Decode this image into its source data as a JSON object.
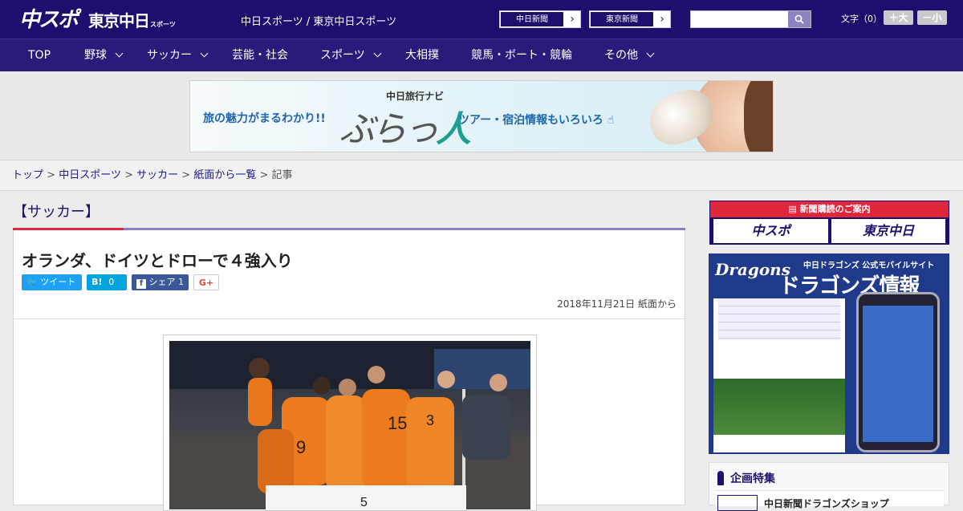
{
  "header": {
    "logo_main": "中スポ",
    "logo_sub": "東京中日",
    "logo_small": "スポーツ",
    "site_title": "中日スポーツ / 東京中日スポーツ",
    "paper_buttons": [
      "中日新聞",
      "東京新聞"
    ],
    "search_placeholder": "",
    "font_size_label": "文字（0）",
    "font_larger": "＋大",
    "font_smaller": "－小"
  },
  "nav": {
    "items": [
      {
        "label": "TOP",
        "has_dropdown": false
      },
      {
        "label": "野球",
        "has_dropdown": true
      },
      {
        "label": "サッカー",
        "has_dropdown": true
      },
      {
        "label": "芸能・社会",
        "has_dropdown": false
      },
      {
        "label": "スポーツ",
        "has_dropdown": true
      },
      {
        "label": "大相撲",
        "has_dropdown": false
      },
      {
        "label": "競馬・ボート・競輪",
        "has_dropdown": false
      },
      {
        "label": "その他",
        "has_dropdown": true
      }
    ]
  },
  "ad_banner": {
    "left_text": "旅の魅力がまるわかり!!",
    "brand_top": "中日旅行ナビ",
    "brand_main": "ぶらっ人",
    "right_text": "ツアー・宿泊情報もいろいろ"
  },
  "breadcrumb": {
    "items": [
      "トップ",
      "中日スポーツ",
      "サッカー",
      "紙面から一覧",
      "記事"
    ],
    "separator": ">"
  },
  "article": {
    "category": "【サッカー】",
    "title": "オランダ、ドイツとドローで４強入り",
    "share": {
      "tweet_label": "ツイート",
      "hatena_label": "B!",
      "hatena_count": "0",
      "facebook_label": "シェア",
      "facebook_count": "1",
      "gplus_label": "G+"
    },
    "date": "2018年11月21日 紙面から"
  },
  "sidebar": {
    "subscription_header": "新聞購読のご案内",
    "subscription_papers": [
      "中スポ",
      "東京中日"
    ],
    "dragons_logo": "Dragons",
    "dragons_tagline": "中日ドラゴンズ 公式モバイルサイト",
    "dragons_title": "ドラゴンズ情報",
    "feature_heading": "企画特集",
    "feature_item": "中日新聞ドラゴンズショップ"
  },
  "colors": {
    "brand_navy": "#1e0e6e",
    "accent_red": "#e0263a",
    "twitter": "#1da1f2",
    "facebook": "#3b5998",
    "hatena": "#00a4de"
  }
}
